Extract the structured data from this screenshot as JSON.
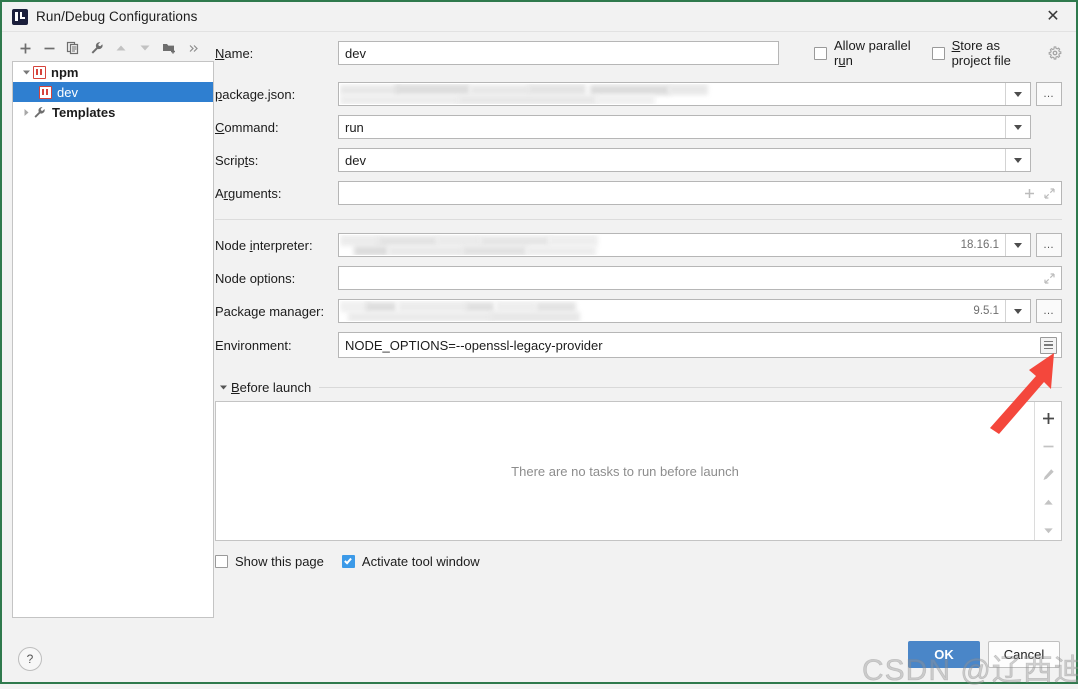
{
  "window": {
    "title": "Run/Debug Configurations",
    "close_label": "✕",
    "app_icon": "intellij-idea-icon"
  },
  "toolbar": {
    "buttons": [
      {
        "name": "add-configuration-button",
        "icon": "plus-icon",
        "label": "+"
      },
      {
        "name": "remove-configuration-button",
        "icon": "minus-icon",
        "label": "−"
      },
      {
        "name": "copy-configuration-button",
        "icon": "copy-icon",
        "label": ""
      },
      {
        "name": "edit-templates-button",
        "icon": "wrench-icon",
        "label": ""
      },
      {
        "name": "move-up-button",
        "icon": "arrow-up-icon",
        "label": ""
      },
      {
        "name": "move-down-button",
        "icon": "arrow-down-icon",
        "label": ""
      },
      {
        "name": "new-folder-button",
        "icon": "folder-add-icon",
        "label": ""
      },
      {
        "name": "more-options-button",
        "icon": "chevron-double-right-icon",
        "label": "»"
      }
    ]
  },
  "tree": {
    "nodes": [
      {
        "name": "tree-node-npm",
        "label": "npm",
        "icon": "npm-icon",
        "expanded": true,
        "selected": false,
        "level": 0
      },
      {
        "name": "tree-node-dev",
        "label": "dev",
        "icon": "npm-icon",
        "expanded": false,
        "selected": true,
        "level": 1
      },
      {
        "name": "tree-node-templates",
        "label": "Templates",
        "icon": "wrench-icon",
        "expanded": false,
        "selected": false,
        "level": 0
      }
    ]
  },
  "form": {
    "name": {
      "label": "Name:",
      "mnemonic": "N",
      "value": "dev",
      "placeholder": ""
    },
    "allow_parallel_run": {
      "label": "Allow parallel run",
      "mnemonic": "u",
      "checked": false
    },
    "store_as_project_file": {
      "label": "Store as project file",
      "mnemonic": "S",
      "checked": false,
      "gear_icon": "gear-icon"
    },
    "package_json": {
      "label": "package.json:",
      "mnemonic": "p",
      "value": "",
      "redacted": true,
      "browse_label": "…"
    },
    "command": {
      "label": "Command:",
      "mnemonic": "C",
      "value": "run"
    },
    "scripts": {
      "label": "Scripts:",
      "mnemonic": "t",
      "value": "dev"
    },
    "arguments": {
      "label": "Arguments:",
      "mnemonic": "r",
      "value": "",
      "add_icon": "plus-icon",
      "expand_icon": "expand-icon"
    },
    "node_interpreter": {
      "label": "Node interpreter:",
      "mnemonic": "i",
      "value": "",
      "redacted": true,
      "version": "18.16.1",
      "browse_label": "…"
    },
    "node_options": {
      "label": "Node options:",
      "value": "",
      "expand_icon": "expand-icon"
    },
    "package_manager": {
      "label": "Package manager:",
      "value": "",
      "redacted": true,
      "version": "9.5.1",
      "browse_label": "…"
    },
    "environment": {
      "label": "Environment:",
      "value": "NODE_OPTIONS=--openssl-legacy-provider",
      "list_icon": "environment-variables-icon"
    }
  },
  "before_launch": {
    "title": "Before launch",
    "mnemonic": "B",
    "expanded": true,
    "empty_text": "There are no tasks to run before launch",
    "side_buttons": [
      {
        "name": "add-task-button",
        "icon": "plus-icon",
        "enabled": true
      },
      {
        "name": "remove-task-button",
        "icon": "minus-icon",
        "enabled": false
      },
      {
        "name": "edit-task-button",
        "icon": "pencil-icon",
        "enabled": false
      },
      {
        "name": "move-task-up-button",
        "icon": "arrow-up-icon",
        "enabled": false
      },
      {
        "name": "move-task-down-button",
        "icon": "arrow-down-icon",
        "enabled": false
      }
    ],
    "show_this_page": {
      "label": "Show this page",
      "checked": false
    },
    "activate_tool_window": {
      "label": "Activate tool window",
      "checked": true
    }
  },
  "footer": {
    "help_label": "?",
    "ok_label": "OK",
    "cancel_label": "Cancel"
  },
  "annotation": {
    "arrow_color": "#f4473c",
    "points_to": "environment-variables-icon"
  },
  "watermark": {
    "text": "CSDN @辽西迪特里斯"
  },
  "colors": {
    "accent": "#4a86c8",
    "selection": "#2f7fd0",
    "checkbox_on": "#3c9ae8",
    "npm_red": "#d6433b",
    "window_border": "#2f7a4d"
  }
}
